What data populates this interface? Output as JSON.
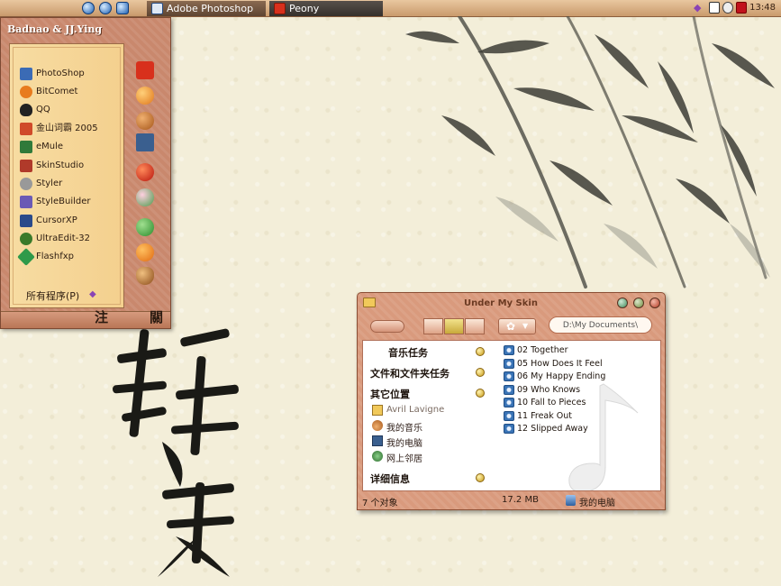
{
  "taskbar": {
    "tasks": [
      {
        "label": "Adobe Photoshop",
        "icon": "photoshop-icon"
      },
      {
        "label": "Peony",
        "icon": "peony-icon"
      }
    ],
    "clock": "13:48"
  },
  "start_menu": {
    "user": "Badnao & JJ.Ying",
    "items": [
      {
        "label": "PhotoShop",
        "icon": "photoshop-icon",
        "color": "#3b6bb5"
      },
      {
        "label": "BitComet",
        "icon": "bitcomet-icon",
        "color": "#e87b1e"
      },
      {
        "label": "QQ",
        "icon": "qq-penguin-icon",
        "color": "#222222"
      },
      {
        "label": "金山词霸 2005",
        "icon": "kingsoft-icon",
        "color": "#d04a2a"
      },
      {
        "label": "eMule",
        "icon": "emule-icon",
        "color": "#2f7a3a"
      },
      {
        "label": "SkinStudio",
        "icon": "skinstudio-icon",
        "color": "#b03a2a"
      },
      {
        "label": "Styler",
        "icon": "styler-icon",
        "color": "#999999"
      },
      {
        "label": "StyleBuilder",
        "icon": "stylebuilder-icon",
        "color": "#6b5ab5"
      },
      {
        "label": "CursorXP",
        "icon": "cursorxp-icon",
        "color": "#2a4a8a"
      },
      {
        "label": "UltraEdit-32",
        "icon": "ultraedit-icon",
        "color": "#3a7a2a"
      },
      {
        "label": "Flashfxp",
        "icon": "flashfxp-icon",
        "color": "#2f9a4a"
      }
    ],
    "all_programs": "所有程序(P)",
    "logoff": "注",
    "shutdown": "關"
  },
  "explorer": {
    "title": "Under My Skin",
    "address": "D:\\My Documents\\",
    "tasks": [
      {
        "label": "音乐任务"
      },
      {
        "label": "文件和文件夹任务"
      },
      {
        "label": "其它位置"
      }
    ],
    "places": [
      {
        "label": "Avril Lavigne",
        "icon": "folder-icon"
      },
      {
        "label": "我的音乐",
        "icon": "music-folder-icon"
      },
      {
        "label": "我的电脑",
        "icon": "computer-icon"
      },
      {
        "label": "网上邻居",
        "icon": "network-icon"
      }
    ],
    "details": "详细信息",
    "files": [
      "02 Together",
      "05 How Does It Feel",
      "06 My Happy Ending",
      "09 Who Knows",
      "10 Fall to Pieces",
      "11 Freak Out",
      "12 Slipped Away"
    ],
    "status": {
      "count": "7 个对象",
      "size": "17.2 MB",
      "location": "我的电脑"
    }
  }
}
